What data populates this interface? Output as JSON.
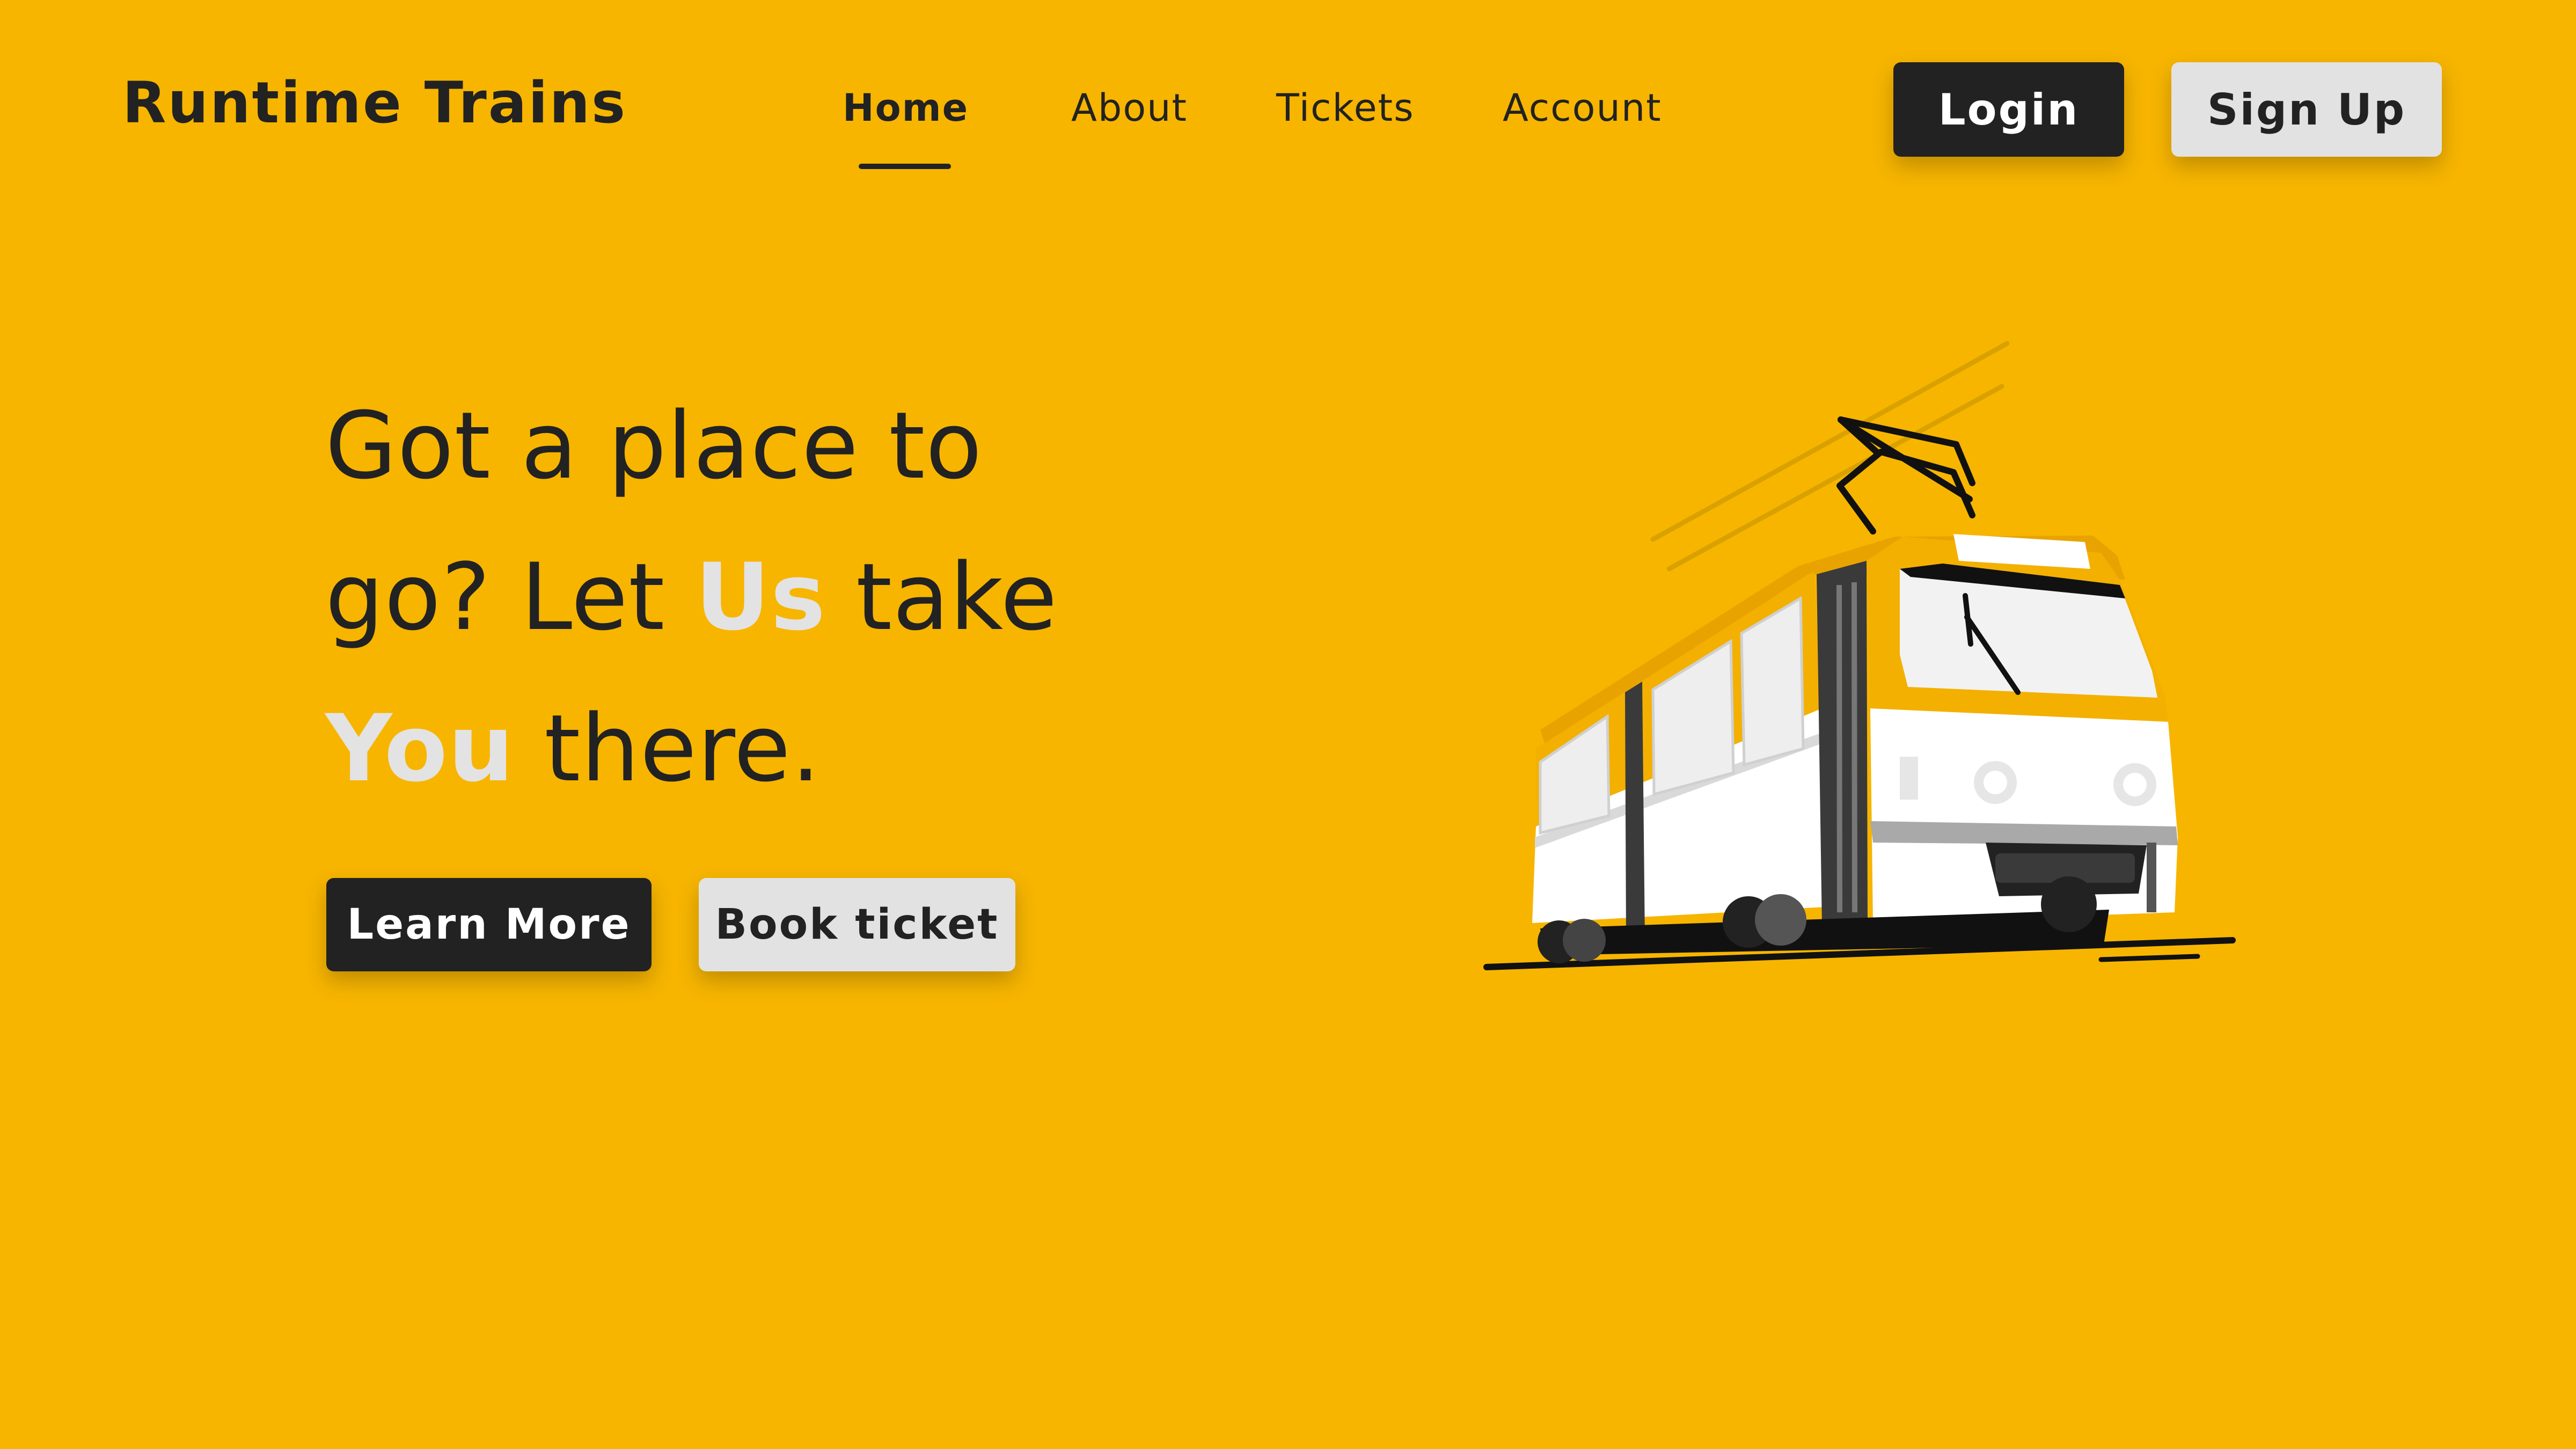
{
  "brand": {
    "name": "Runtime Trains"
  },
  "nav": {
    "items": [
      {
        "label": "Home",
        "active": true
      },
      {
        "label": "About",
        "active": false
      },
      {
        "label": "Tickets",
        "active": false
      },
      {
        "label": "Account",
        "active": false
      }
    ]
  },
  "auth": {
    "login_label": "Login",
    "signup_label": "Sign Up"
  },
  "hero": {
    "line1": "Got a place to",
    "line2_pre": "go? Let ",
    "line2_highlight": "Us",
    "line2_post": " take",
    "line3_highlight": "You",
    "line3_post": " there.",
    "primary_cta": "Learn More",
    "secondary_cta": "Book ticket"
  },
  "illustration": {
    "icon": "tram-icon"
  },
  "colors": {
    "background": "#F7B500",
    "text_dark": "#222222",
    "highlight": "#E3E3E3",
    "button_dark": "#222222",
    "button_light": "#E2E2E2"
  }
}
